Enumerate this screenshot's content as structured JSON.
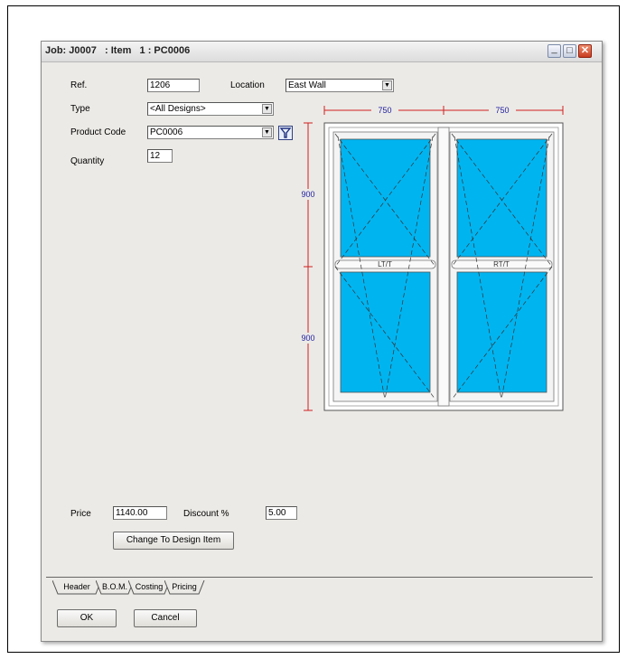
{
  "window": {
    "title": "Job: J0007   : Item   1 : PC0006"
  },
  "form": {
    "ref_label": "Ref.",
    "ref_value": "1206",
    "location_label": "Location",
    "location_value": "East Wall",
    "type_label": "Type",
    "type_value": "<All Designs>",
    "product_code_label": "Product Code",
    "product_code_value": "PC0006",
    "quantity_label": "Quantity",
    "quantity_value": "12",
    "price_label": "Price",
    "price_value": "1140.00",
    "discount_label": "Discount %",
    "discount_value": "5.00",
    "change_design_button": "Change To Design Item"
  },
  "drawing": {
    "width_left": "750",
    "width_right": "750",
    "height_top": "900",
    "height_bottom": "900",
    "sash_left_label": "LT/T",
    "sash_right_label": "RT/T",
    "glass_color": "#00b4f0",
    "dimension_color": "#d02020",
    "dimension_text_color": "#2020a0"
  },
  "tabs": [
    {
      "label": "Header"
    },
    {
      "label": "B.O.M."
    },
    {
      "label": "Costing"
    },
    {
      "label": "Pricing"
    }
  ],
  "footer": {
    "ok_label": "OK",
    "cancel_label": "Cancel"
  }
}
